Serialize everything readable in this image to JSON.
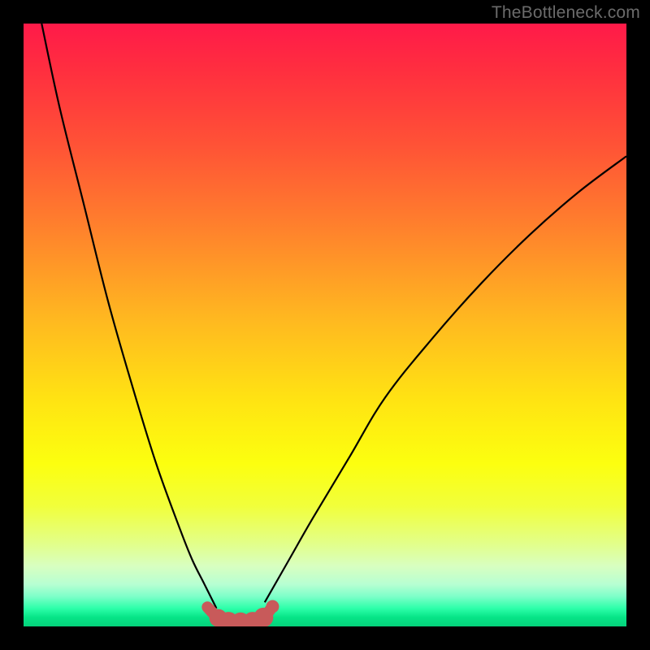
{
  "watermark": "TheBottleneck.com",
  "colors": {
    "background": "#000000",
    "curve_stroke": "#000000",
    "marker_stroke": "#c85a5a",
    "marker_fill": "#c85a5a"
  },
  "chart_data": {
    "type": "line",
    "title": "",
    "xlabel": "",
    "ylabel": "",
    "xlim": [
      0,
      100
    ],
    "ylim": [
      0,
      100
    ],
    "grid": false,
    "series": [
      {
        "name": "left-curve",
        "x": [
          3,
          6,
          10,
          14,
          18,
          22,
          26,
          28,
          30,
          32
        ],
        "values": [
          100,
          86,
          70,
          54,
          40,
          27,
          16,
          11,
          7,
          3
        ]
      },
      {
        "name": "right-curve",
        "x": [
          40,
          44,
          48,
          54,
          60,
          68,
          76,
          84,
          92,
          100
        ],
        "values": [
          4,
          11,
          18,
          28,
          38,
          48,
          57,
          65,
          72,
          78
        ]
      }
    ],
    "markers": {
      "name": "bottom-markers",
      "x": [
        30.5,
        32.3,
        34.0,
        36.0,
        38.0,
        39.8,
        41.3
      ],
      "values": [
        3.2,
        1.4,
        0.8,
        0.7,
        0.8,
        1.5,
        3.3
      ],
      "sizes": [
        6,
        11,
        12,
        12,
        12,
        12,
        8
      ]
    }
  }
}
